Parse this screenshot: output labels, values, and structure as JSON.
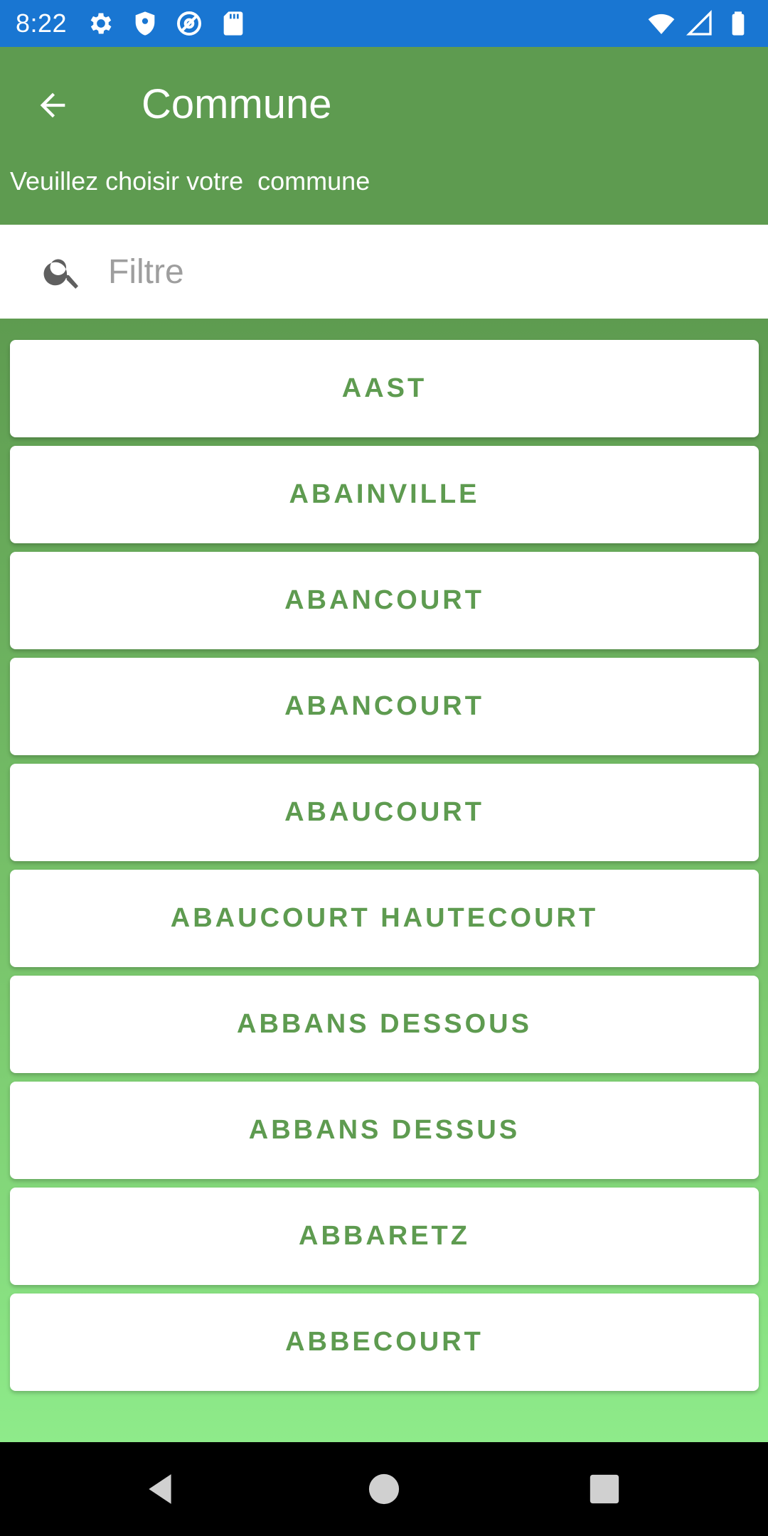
{
  "status_bar": {
    "time": "8:22",
    "icons_left": [
      "gear-icon",
      "shield-icon",
      "at-sign-icon",
      "sd-card-icon"
    ],
    "icons_right": [
      "wifi-icon",
      "cellular-signal-icon",
      "battery-icon"
    ],
    "background": "#1976D2"
  },
  "app_bar": {
    "title": "Commune",
    "subtitle": "Veuillez choisir votre  commune",
    "background": "#5E9B50"
  },
  "search": {
    "placeholder": "Filtre",
    "value": ""
  },
  "communes": [
    {
      "label": "AAST"
    },
    {
      "label": "ABAINVILLE"
    },
    {
      "label": "ABANCOURT"
    },
    {
      "label": "ABANCOURT"
    },
    {
      "label": "ABAUCOURT"
    },
    {
      "label": "ABAUCOURT HAUTECOURT"
    },
    {
      "label": "ABBANS DESSOUS"
    },
    {
      "label": "ABBANS DESSUS"
    },
    {
      "label": "ABBARETZ"
    },
    {
      "label": "ABBECOURT"
    }
  ],
  "colors": {
    "accent": "#5E9B50",
    "list_bottom": "#8EEB8A"
  },
  "nav_bar": {
    "buttons": [
      "back-triangle-icon",
      "home-circle-icon",
      "recents-square-icon"
    ]
  }
}
